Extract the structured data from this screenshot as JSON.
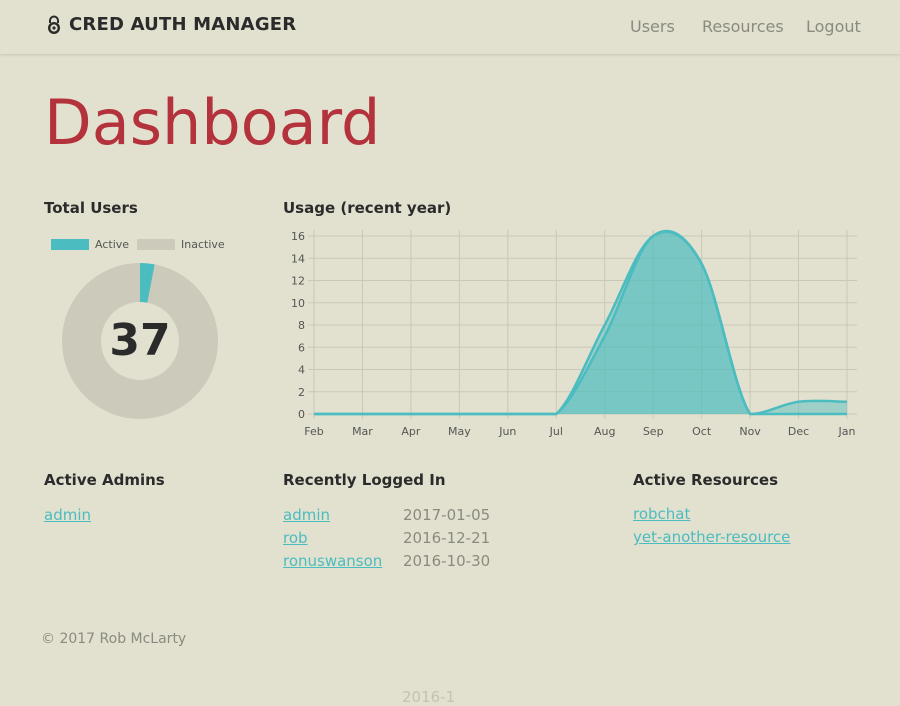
{
  "navbar": {
    "brand": "CRED AUTH MANAGER",
    "brand_icon": "lock-icon",
    "links": [
      "Users",
      "Resources",
      "Logout"
    ]
  },
  "page_title": "Dashboard",
  "total_users": {
    "title": "Total Users",
    "count": "37",
    "legend": [
      "Active",
      "Inactive"
    ],
    "active_fraction": 0.03,
    "colors": {
      "active": "#4bbcbf",
      "inactive": "#cbcabb"
    }
  },
  "usage": {
    "title": "Usage (recent year)"
  },
  "chart_data": {
    "type": "area",
    "title": "Usage (recent year)",
    "categories": [
      "Feb",
      "Mar",
      "Apr",
      "May",
      "Jun",
      "Jul",
      "Aug",
      "Sep",
      "Oct",
      "Nov",
      "Dec",
      "Jan"
    ],
    "yticks": [
      0,
      2,
      4,
      6,
      8,
      10,
      12,
      14,
      16
    ],
    "ylim": [
      0,
      16
    ],
    "grid": true,
    "series": [
      {
        "values": [
          0,
          0,
          0,
          0,
          0,
          0,
          7,
          16,
          13.5,
          0,
          0,
          0
        ]
      },
      {
        "values": [
          0,
          0,
          0,
          0,
          0,
          0,
          8,
          16,
          13.5,
          0,
          1.1,
          1.1
        ]
      }
    ],
    "color": "#4bbcbf"
  },
  "admins": {
    "title": "Active Admins",
    "items": [
      "admin"
    ]
  },
  "recent": {
    "title": "Recently Logged In",
    "rows": [
      {
        "user": "admin",
        "date": "2017-01-05"
      },
      {
        "user": "rob",
        "date": "2016-12-21"
      },
      {
        "user": "ronuswanson",
        "date": "2016-10-30"
      }
    ]
  },
  "resources": {
    "title": "Active Resources",
    "items": [
      "robchat",
      "yet-another-resource"
    ]
  },
  "footer": "© 2017 Rob McLarty",
  "ghost_text": "2016-1"
}
